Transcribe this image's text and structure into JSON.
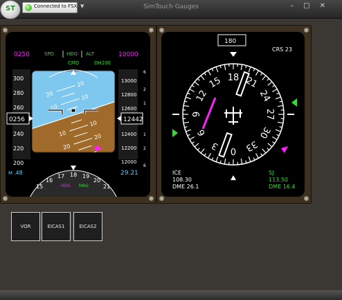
{
  "app": {
    "title": "SimTouch Gauges",
    "logo_text": "ST",
    "connection_status": "Connected to FSX"
  },
  "colors": {
    "sky": "#7ec8f0",
    "ground": "#a06a2a",
    "magenta": "#ff22ff",
    "green": "#33dd33",
    "cyan": "#55ccff"
  },
  "pfd": {
    "selected_speed": "0250",
    "selected_altitude": "10000",
    "fma": {
      "spd": "SPD",
      "hdg": "HDG",
      "alt": "ALT",
      "cmd": "CMD",
      "dh": "DH200"
    },
    "speed_tape": [
      "300",
      "280",
      "260",
      "240",
      "220",
      "200"
    ],
    "speed_readout": "0256",
    "mach": ".48",
    "alt_tape": [
      "13000",
      "12800",
      "12600",
      "12400",
      "12200",
      "12000"
    ],
    "alt_readout": "12442",
    "baro": "29.21",
    "pitch_marks_left": [
      "20",
      "10",
      "10",
      "20"
    ],
    "pitch_marks_right": [
      "20",
      "10",
      "10",
      "20"
    ],
    "heading_labels": [
      "15",
      "16",
      "17",
      "18",
      "19",
      "20",
      "21"
    ],
    "hdg_label": "HDG",
    "mag_label": "MAG",
    "vsi": [
      "6",
      "2",
      "1",
      "1",
      "2",
      "6"
    ]
  },
  "hsi": {
    "heading": "180",
    "course": "CRS 23",
    "compass": [
      "18",
      "21",
      "24",
      "27",
      "30",
      "33",
      "0",
      "3",
      "6",
      "9",
      "12",
      "15"
    ],
    "nav1_id": "ICE",
    "nav1_freq": "108.30",
    "nav1_dme": "DME 26.1",
    "nav2_id": "SJ",
    "nav2_freq": "113.50",
    "nav2_dme": "DME 16.4"
  },
  "buttons": {
    "vor": "VOR",
    "eicas1": "EICAS1",
    "eicas2": "EICAS2"
  }
}
